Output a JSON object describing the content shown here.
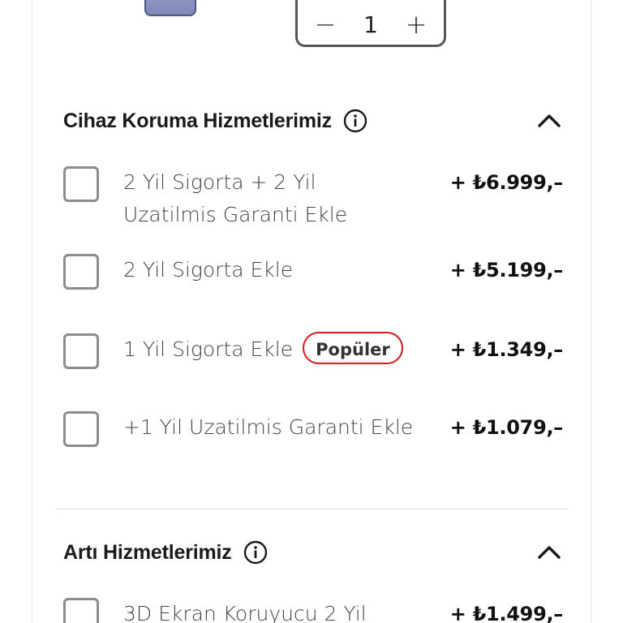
{
  "quantity": {
    "decrement_symbol": "−",
    "value": "1",
    "increment_symbol": "+"
  },
  "sections": [
    {
      "title": "Cihaz Koruma Hizmetlerimiz",
      "info_icon": "info-circle-icon",
      "toggle_icon": "chevron-up-icon",
      "options": [
        {
          "label": "2 Yil Sigorta + 2 Yil Uzatilmis Garanti Ekle",
          "price": "+ ₺6.999,–",
          "checked": false
        },
        {
          "label": "2 Yil Sigorta Ekle",
          "price": "+ ₺5.199,–",
          "checked": false
        },
        {
          "label": "1 Yil Sigorta Ekle",
          "badge": "Popüler",
          "price": "+ ₺1.349,–",
          "checked": false
        },
        {
          "label": "+1 Yil Uzatilmis Garanti Ekle",
          "price": "+ ₺1.079,–",
          "checked": false
        }
      ]
    },
    {
      "title": "Artı Hizmetlerimiz",
      "info_icon": "info-circle-icon",
      "toggle_icon": "chevron-up-icon",
      "options": [
        {
          "label": "3D Ekran Koruyucu 2 Yil",
          "price": "+ ₺1.499,–",
          "checked": false
        }
      ]
    }
  ],
  "colors": {
    "badge_border": "#d0191e",
    "checkbox_border": "#8c8c8c",
    "text_primary": "#1a1a1a"
  }
}
